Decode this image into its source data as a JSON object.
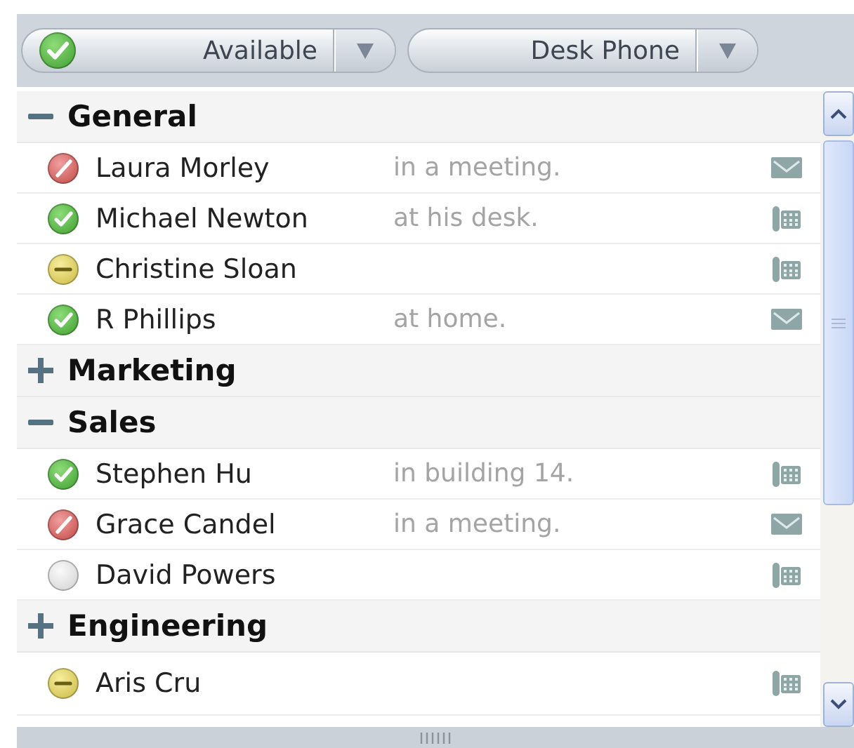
{
  "toolbar": {
    "presence": {
      "label": "Available",
      "status_icon": {
        "kind": "available"
      }
    },
    "device": {
      "label": "Desk Phone"
    }
  },
  "groups": [
    {
      "name": "General",
      "expanded": true,
      "contacts": [
        {
          "name": "Laura Morley",
          "status_icon": {
            "kind": "busy"
          },
          "note": "in a meeting.",
          "channel_icon": {
            "kind": "mail"
          }
        },
        {
          "name": "Michael Newton",
          "status_icon": {
            "kind": "available"
          },
          "note": "at his desk.",
          "channel_icon": {
            "kind": "phone"
          }
        },
        {
          "name": "Christine Sloan",
          "status_icon": {
            "kind": "away"
          },
          "channel_icon": {
            "kind": "phone"
          }
        },
        {
          "name": "R Phillips",
          "status_icon": {
            "kind": "available"
          },
          "note": "at home.",
          "channel_icon": {
            "kind": "mail"
          }
        }
      ]
    },
    {
      "name": "Marketing",
      "expanded": false
    },
    {
      "name": "Sales",
      "expanded": true,
      "contacts": [
        {
          "name": "Stephen Hu",
          "status_icon": {
            "kind": "available"
          },
          "note": "in building 14.",
          "channel_icon": {
            "kind": "phone"
          }
        },
        {
          "name": "Grace Candel",
          "status_icon": {
            "kind": "busy"
          },
          "note": "in a meeting.",
          "channel_icon": {
            "kind": "mail"
          }
        },
        {
          "name": "David Powers",
          "status_icon": {
            "kind": "offline"
          },
          "channel_icon": {
            "kind": "phone"
          }
        }
      ]
    },
    {
      "name": "Engineering",
      "expanded": false
    }
  ],
  "contacts": [
    {
      "name": "Aris Cru",
      "status_icon": {
        "kind": "away"
      },
      "channel_icon": {
        "kind": "phone"
      }
    }
  ]
}
